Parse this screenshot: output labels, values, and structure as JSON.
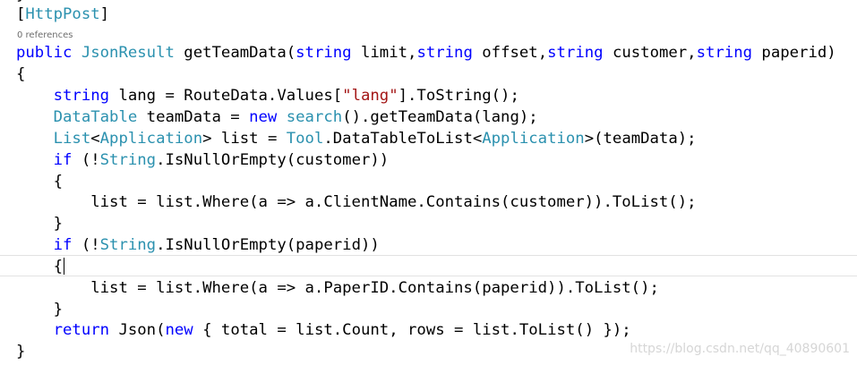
{
  "editor": {
    "top_stub": "}",
    "codelens": "0 references",
    "colors": {
      "text": "#000000",
      "keyword": "#0000ff",
      "type": "#2b91af",
      "string": "#a31515",
      "codelens": "#6e6e6e"
    },
    "lines": [
      [
        [
          "[",
          "plain"
        ],
        [
          "HttpPost",
          "type"
        ],
        [
          "]",
          "plain"
        ]
      ],
      [
        [
          "public",
          "kw"
        ],
        [
          " ",
          "plain"
        ],
        [
          "JsonResult",
          "type"
        ],
        [
          " getTeamData(",
          "plain"
        ],
        [
          "string",
          "kw"
        ],
        [
          " limit,",
          "plain"
        ],
        [
          "string",
          "kw"
        ],
        [
          " offset,",
          "plain"
        ],
        [
          "string",
          "kw"
        ],
        [
          " customer,",
          "plain"
        ],
        [
          "string",
          "kw"
        ],
        [
          " paperid)",
          "plain"
        ]
      ],
      [
        [
          "{",
          "plain"
        ]
      ],
      [
        [
          "    ",
          "plain"
        ],
        [
          "string",
          "kw"
        ],
        [
          " lang = RouteData.Values[",
          "plain"
        ],
        [
          "\"lang\"",
          "str"
        ],
        [
          "].ToString();",
          "plain"
        ]
      ],
      [
        [
          "    ",
          "plain"
        ],
        [
          "DataTable",
          "type"
        ],
        [
          " teamData = ",
          "plain"
        ],
        [
          "new",
          "kw"
        ],
        [
          " ",
          "plain"
        ],
        [
          "search",
          "type"
        ],
        [
          "().getTeamData(lang);",
          "plain"
        ]
      ],
      [
        [
          "    ",
          "plain"
        ],
        [
          "List",
          "type"
        ],
        [
          "<",
          "plain"
        ],
        [
          "Application",
          "type"
        ],
        [
          "> list = ",
          "plain"
        ],
        [
          "Tool",
          "type"
        ],
        [
          ".DataTableToList<",
          "plain"
        ],
        [
          "Application",
          "type"
        ],
        [
          ">(teamData);",
          "plain"
        ]
      ],
      [
        [
          "    ",
          "plain"
        ],
        [
          "if",
          "kw"
        ],
        [
          " (!",
          "plain"
        ],
        [
          "String",
          "type"
        ],
        [
          ".IsNullOrEmpty(customer))",
          "plain"
        ]
      ],
      [
        [
          "    {",
          "plain"
        ]
      ],
      [
        [
          "        list = list.Where(a => a.ClientName.Contains(customer)).ToList();",
          "plain"
        ]
      ],
      [
        [
          "    }",
          "plain"
        ]
      ],
      [
        [
          "    ",
          "plain"
        ],
        [
          "if",
          "kw"
        ],
        [
          " (!",
          "plain"
        ],
        [
          "String",
          "type"
        ],
        [
          ".IsNullOrEmpty(paperid))",
          "plain"
        ]
      ],
      [
        [
          "    {",
          "plain"
        ]
      ],
      [
        [
          "        list = list.Where(a => a.PaperID.Contains(paperid)).ToList();",
          "plain"
        ]
      ],
      [
        [
          "    }",
          "plain"
        ]
      ],
      [
        [
          "    ",
          "plain"
        ],
        [
          "return",
          "kw"
        ],
        [
          " Json(",
          "plain"
        ],
        [
          "new",
          "kw"
        ],
        [
          " { total = list.Count, rows = list.ToList() });",
          "plain"
        ]
      ],
      [
        [
          "}",
          "plain"
        ]
      ]
    ]
  },
  "watermark": "https://blog.csdn.net/qq_40890601"
}
